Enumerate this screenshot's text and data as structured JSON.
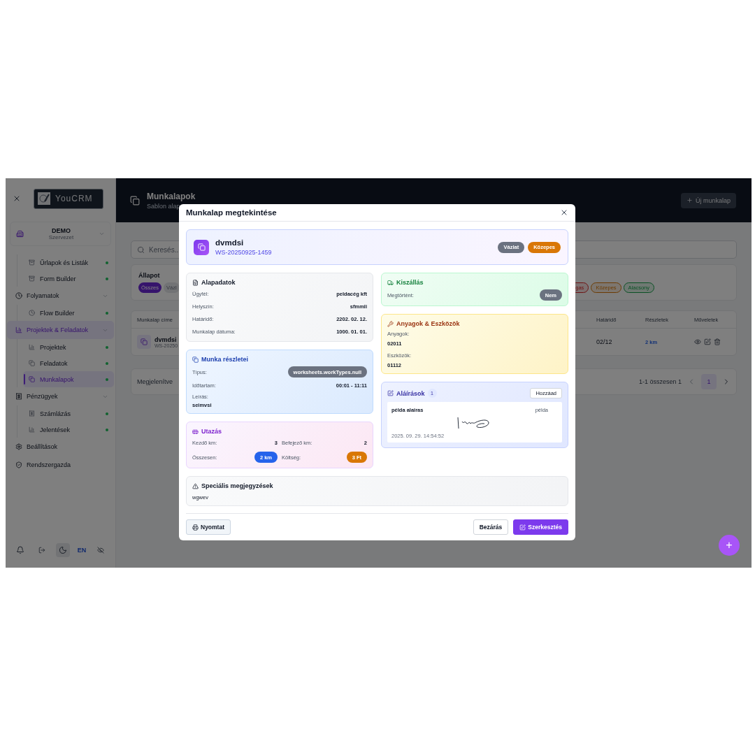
{
  "sidebar": {
    "logo": "YouCRM",
    "org": {
      "name": "DEMO",
      "subtitle": "Szervezet"
    },
    "nav": [
      {
        "children": [
          {
            "label": "Űrlapok és Listák",
            "selected": false
          },
          {
            "label": "Form Builder",
            "selected": false
          }
        ]
      },
      {
        "label": "Folyamatok",
        "selected": false,
        "expanded": true,
        "children": [
          {
            "label": "Flow Builder",
            "selected": false
          }
        ]
      },
      {
        "label": "Projektek & Feladatok",
        "selected": true,
        "expanded": true,
        "children": [
          {
            "label": "Projektek",
            "selected": false
          },
          {
            "label": "Feladatok",
            "selected": false
          },
          {
            "label": "Munkalapok",
            "selected": true
          }
        ]
      },
      {
        "label": "Pénzügyek",
        "selected": false,
        "expanded": true,
        "children": [
          {
            "label": "Számlázás",
            "selected": false
          },
          {
            "label": "Jelentések",
            "selected": false
          }
        ]
      },
      {
        "label": "Beállítások",
        "selected": false
      },
      {
        "label": "Rendszergazda",
        "selected": false
      }
    ],
    "language": "EN"
  },
  "header": {
    "title": "Munkalapok",
    "subtitle": "Sablon alap",
    "new_button": "Új munkalap"
  },
  "search": {
    "placeholder": "Keresés..."
  },
  "filters": {
    "label": "Állapot",
    "status_chips": [
      {
        "label": "Összes",
        "selected": true
      },
      {
        "label": "Vázl",
        "selected": false
      }
    ],
    "priority_chips": [
      {
        "label": "gas",
        "kind": "high"
      },
      {
        "label": "Közepes",
        "kind": "medium"
      },
      {
        "label": "Alacsony",
        "kind": "low"
      }
    ]
  },
  "table": {
    "columns": [
      {
        "label": "Munkalap címe"
      },
      {
        "label": "Határidő"
      },
      {
        "label": "Részletek"
      },
      {
        "label": "Műveletek"
      }
    ],
    "rows": [
      {
        "title": "dvmdsi",
        "code": "WS-20250",
        "deadline": "02/12",
        "details": "2 km"
      }
    ]
  },
  "pagination": {
    "showing": "Megjelenítve",
    "range": "1-1 összesen 1",
    "pages": [
      {
        "label": "1",
        "selected": true
      }
    ]
  },
  "fab": "+",
  "modal": {
    "title": "Munkalap megtekintése",
    "summary": {
      "name": "dvmdsi",
      "code": "WS-20250925-1459",
      "badges": [
        {
          "label": "Vázlat",
          "color": "#6b7280"
        },
        {
          "label": "Közepes",
          "color": "#d97706"
        }
      ]
    },
    "basic": {
      "title": "Alapadatok",
      "fields": [
        {
          "label": "Ügyfél:",
          "value": "peldacég kft"
        },
        {
          "label": "Helyszín:",
          "value": "sfmmli"
        },
        {
          "label": "Határidő:",
          "value": "2202. 02. 12."
        },
        {
          "label": "Munkalap dátuma:",
          "value": "1000. 01. 01."
        }
      ]
    },
    "work": {
      "title": "Munka részletei",
      "type_label": "Típus:",
      "type": "worksheets.workTypes.null",
      "duration_label": "Időtartam:",
      "duration": "00:01 - 11:11",
      "description_label": "Leírás:",
      "description": "seimvsi"
    },
    "travel": {
      "title": "Utazás",
      "start_label": "Kezdő km:",
      "start": "3",
      "end_label": "Befejező km:",
      "end": "2",
      "total_label": "Összesen:",
      "total": "2 km",
      "cost_label": "Költség:",
      "cost": "3 Ft"
    },
    "shipping": {
      "title": "Kiszállás",
      "done_label": "Megtörtént:",
      "done": "Nem"
    },
    "materials": {
      "title": "Anyagok & Eszközök",
      "materials_label": "Anyagok:",
      "materials": "02011",
      "tools_label": "Eszközök:",
      "tools": "01112"
    },
    "signatures": {
      "title": "Aláírások",
      "count": "1",
      "add_button": "Hozzáad",
      "items": [
        {
          "name": "példa alairas",
          "role": "példa",
          "time": "2025. 09. 29. 14:54:52"
        }
      ]
    },
    "notes": {
      "title": "Speciális megjegyzések",
      "text": "wgwev"
    },
    "footer": {
      "print": "Nyomtat",
      "close": "Bezárás",
      "edit": "Szerkesztés"
    }
  }
}
